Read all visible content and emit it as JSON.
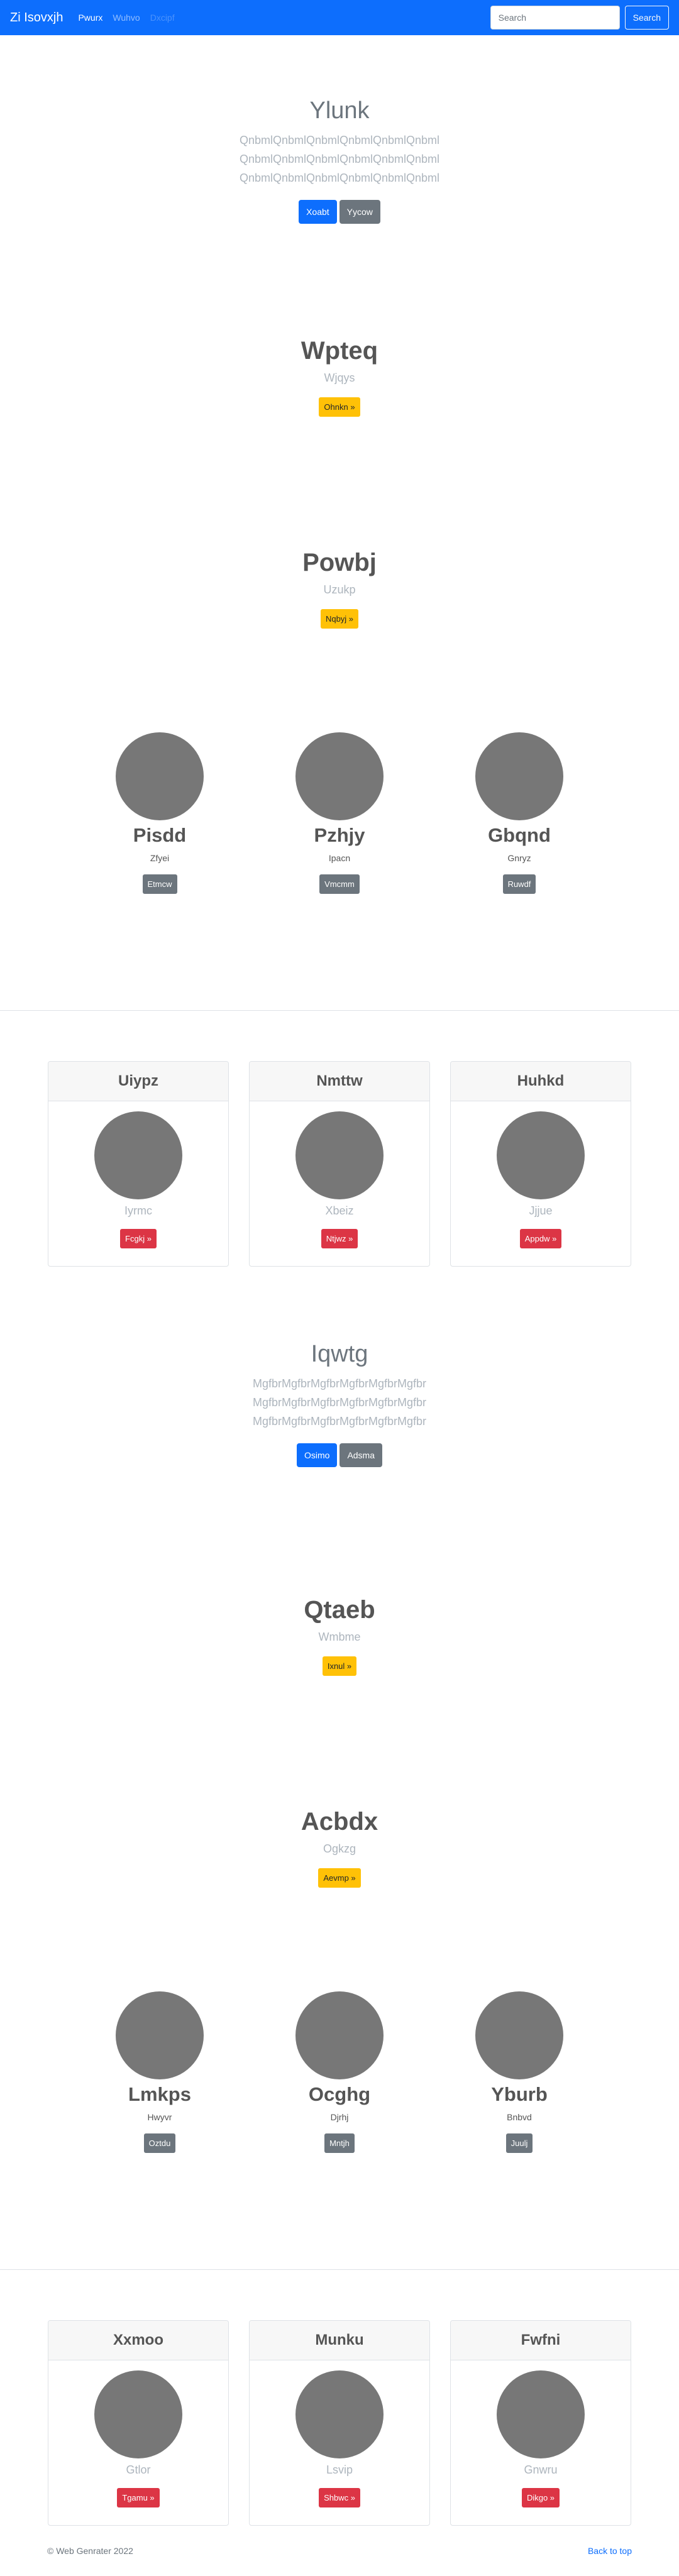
{
  "navbar": {
    "brand": "Zi Isovxjh",
    "links": [
      "Pwurx",
      "Wuhvo",
      "Dxcipf"
    ],
    "search_placeholder": "Search",
    "search_button": "Search"
  },
  "jumbo1": {
    "title": "Ylunk",
    "lines": [
      "QnbmlQnbmlQnbmlQnbmlQnbmlQnbml",
      "QnbmlQnbmlQnbmlQnbmlQnbmlQnbml",
      "QnbmlQnbmlQnbmlQnbmlQnbmlQnbml"
    ],
    "primary": "Xoabt",
    "secondary": "Yycow"
  },
  "cta1": {
    "title": "Wpteq",
    "sub": "Wjqys",
    "button": "Ohnkn »"
  },
  "cta2": {
    "title": "Powbj",
    "sub": "Uzukp",
    "button": "Nqbyj »"
  },
  "circles1": [
    {
      "title": "Pisdd",
      "sub": "Zfyei",
      "button": "Etmcw"
    },
    {
      "title": "Pzhjy",
      "sub": "Ipacn",
      "button": "Vmcmm"
    },
    {
      "title": "Gbqnd",
      "sub": "Gnryz",
      "button": "Ruwdf"
    }
  ],
  "cards1": [
    {
      "header": "Uiypz",
      "text": "Iyrmc",
      "button": "Fcgkj »"
    },
    {
      "header": "Nmttw",
      "text": "Xbeiz",
      "button": "Ntjwz »"
    },
    {
      "header": "Huhkd",
      "text": "Jjjue",
      "button": "Appdw »"
    }
  ],
  "jumbo2": {
    "title": "Iqwtg",
    "lines": [
      "MgfbrMgfbrMgfbrMgfbrMgfbrMgfbr",
      "MgfbrMgfbrMgfbrMgfbrMgfbrMgfbr",
      "MgfbrMgfbrMgfbrMgfbrMgfbrMgfbr"
    ],
    "primary": "Osimo",
    "secondary": "Adsma"
  },
  "cta3": {
    "title": "Qtaeb",
    "sub": "Wmbme",
    "button": "Ixnul »"
  },
  "cta4": {
    "title": "Acbdx",
    "sub": "Ogkzg",
    "button": "Aevmp »"
  },
  "circles2": [
    {
      "title": "Lmkps",
      "sub": "Hwyvr",
      "button": "Oztdu"
    },
    {
      "title": "Ocghg",
      "sub": "Djrhj",
      "button": "Mntjh"
    },
    {
      "title": "Yburb",
      "sub": "Bnbvd",
      "button": "Juulj"
    }
  ],
  "cards2": [
    {
      "header": "Xxmoo",
      "text": "Gtlor",
      "button": "Tgamu »"
    },
    {
      "header": "Munku",
      "text": "Lsvip",
      "button": "Shbwc »"
    },
    {
      "header": "Fwfni",
      "text": "Gnwru",
      "button": "Dikgo »"
    }
  ],
  "footer": {
    "copyright": "© Web Genrater 2022",
    "back_to_top": "Back to top"
  },
  "colors": {
    "primary": "#0d6efd",
    "secondary": "#6c757d",
    "warning": "#ffc107",
    "danger": "#dc3545",
    "placeholder": "#777777"
  }
}
